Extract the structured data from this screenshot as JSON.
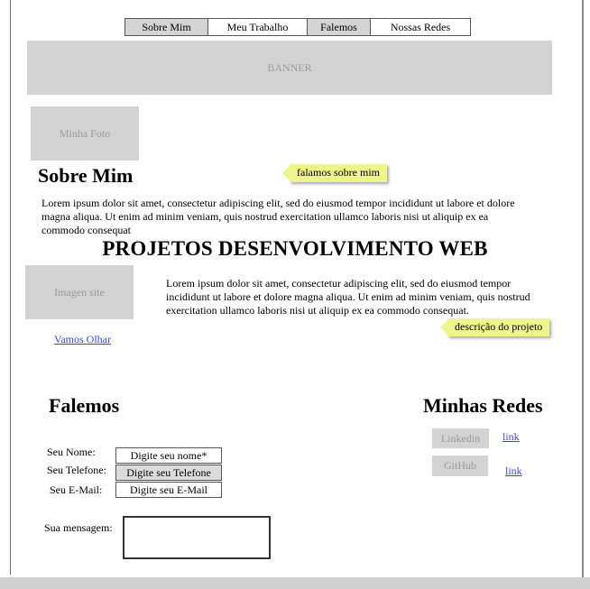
{
  "nav": {
    "items": [
      "Sobre Mim",
      "Meu Trabalho",
      "Falemos",
      "Nossas Redes"
    ]
  },
  "banner": {
    "label": "BANNER"
  },
  "about": {
    "photo_label": "Minha Foto",
    "title": "Sobre Mim",
    "note": "falamos sobre mim",
    "text": "Lorem ipsum dolor sit amet, consectetur adipiscing elit, sed do eiusmod tempor incididunt ut labore et dolore magna aliqua. Ut enim ad minim veniam, quis nostrud exercitation ullamco laboris nisi ut aliquip ex ea commodo consequat"
  },
  "projects": {
    "title": "PROJETOS DESENVOLVIMENTO WEB",
    "image_label": "Imagen site",
    "link": "Vamos Olhar",
    "text": "Lorem ipsum dolor sit amet, consectetur adipiscing elit, sed do eiusmod tempor incididunt ut labore et dolore magna aliqua. Ut enim ad minim veniam, quis nostrud exercitation ullamco laboris nisi ut aliquip ex ea commodo consequat.",
    "note": "descrição do projeto"
  },
  "contact": {
    "title": "Falemos",
    "name_label": "Seu Nome:",
    "name_value": "Digite seu nome*",
    "phone_label": "Seu Telefone:",
    "phone_value": "Digite seu Telefone",
    "email_label": "Seu E-Mail:",
    "email_value": "Digite seu E-Mail",
    "message_label": "Sua mensagem:",
    "message_value": ""
  },
  "networks": {
    "title": "Minhas Redes",
    "linkedin_label": "Linkedin",
    "linkedin_link": "link",
    "github_label": "GitHub",
    "github_link": "link"
  },
  "colors": {
    "placeholder": "#d3d3d3",
    "note": "#eef58c",
    "link": "#3949c9"
  }
}
